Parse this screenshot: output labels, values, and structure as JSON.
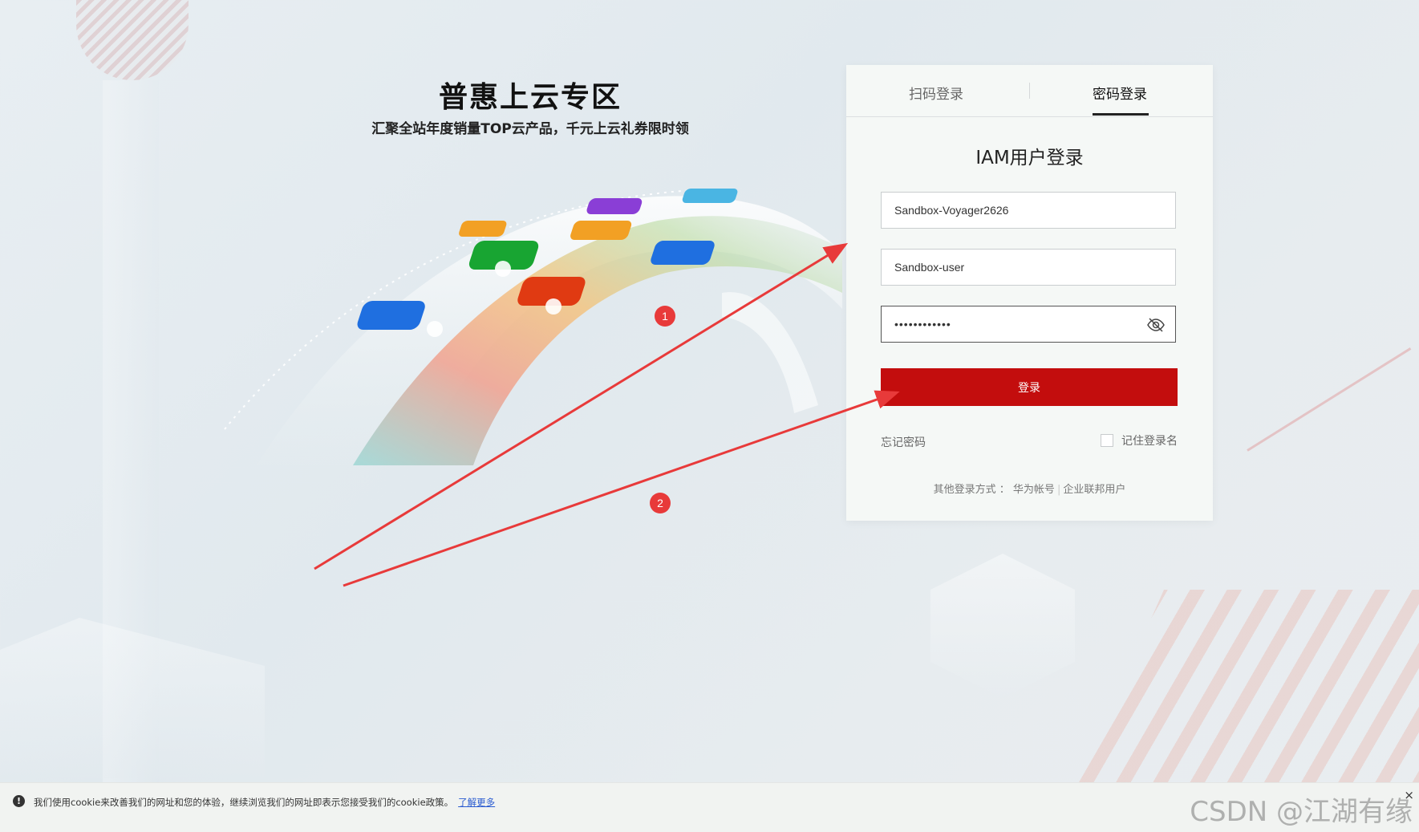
{
  "promo": {
    "title": "普惠上云专区",
    "subtitle": "汇聚全站年度销量TOP云产品，千元上云礼券限时领"
  },
  "login": {
    "tabs": [
      {
        "label": "扫码登录",
        "active": false
      },
      {
        "label": "密码登录",
        "active": true
      }
    ],
    "heading": "IAM用户登录",
    "account_value": "Sandbox-Voyager2626",
    "username_value": "Sandbox-user",
    "password_value": "••••••••••••",
    "submit_label": "登录",
    "forgot_label": "忘记密码",
    "remember_label": "记住登录名",
    "other_label": "其他登录方式 ：",
    "other_option_1": "华为帐号",
    "other_option_2": "企业联邦用户",
    "accent_color": "#c30d0d"
  },
  "annotations": {
    "marker_1": "1",
    "marker_2": "2",
    "color": "#e83a3a"
  },
  "cookie_bar": {
    "text": "我们使用cookie来改善我们的网址和您的体验，继续浏览我们的网址即表示您接受我们的cookie政策。",
    "link": "了解更多",
    "close": "×"
  },
  "watermark": "CSDN @江湖有缘"
}
